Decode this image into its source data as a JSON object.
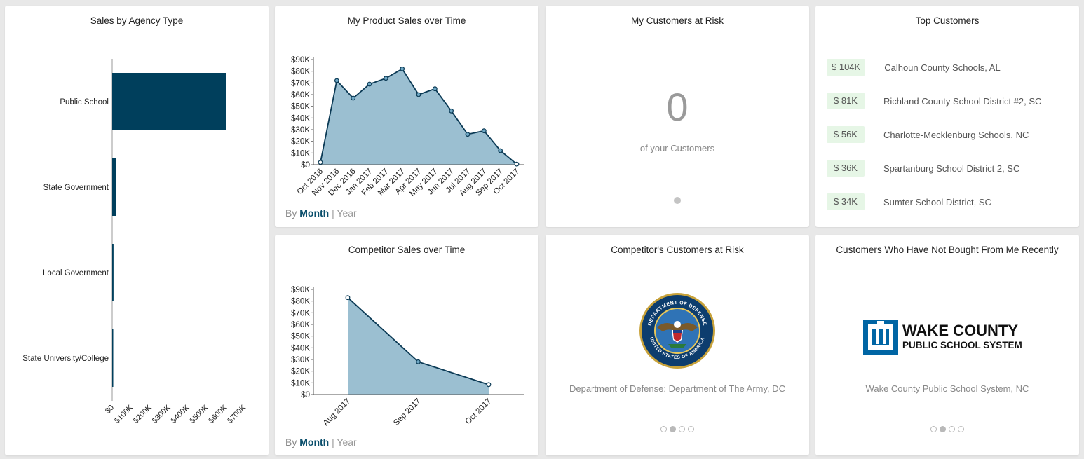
{
  "cards": {
    "agency": {
      "title": "Sales by Agency Type"
    },
    "my_sales": {
      "title": "My Product Sales over Time",
      "by_label": "By",
      "month_label": "Month",
      "sep": "|",
      "year_label": "Year"
    },
    "my_risk": {
      "title": "My Customers at Risk",
      "count": "0",
      "caption": "of your Customers"
    },
    "top_customers": {
      "title": "Top Customers",
      "rows": [
        {
          "amount": "$ 104K",
          "name": "Calhoun County Schools, AL"
        },
        {
          "amount": "$ 81K",
          "name": "Richland County School District #2, SC"
        },
        {
          "amount": "$ 56K",
          "name": "Charlotte-Mecklenburg Schools, NC"
        },
        {
          "amount": "$ 36K",
          "name": "Spartanburg School District 2, SC"
        },
        {
          "amount": "$ 34K",
          "name": "Sumter School District, SC"
        }
      ]
    },
    "competitor_sales": {
      "title": "Competitor Sales over Time",
      "by_label": "By",
      "month_label": "Month",
      "sep": "|",
      "year_label": "Year"
    },
    "competitor_risk": {
      "title": "Competitor's Customers at Risk",
      "caption": "Department of Defense: Department of The Army, DC",
      "seal_text_top": "DEPARTMENT OF DEFENSE",
      "seal_text_bottom": "UNITED STATES OF AMERICA"
    },
    "not_bought": {
      "title": "Customers Who Have Not Bought From Me Recently",
      "caption": "Wake County Public School System, NC",
      "logo_line1": "WAKE COUNTY",
      "logo_line2": "PUBLIC SCHOOL SYSTEM"
    }
  },
  "colors": {
    "navy": "#003f5c",
    "line": "#0b3a55",
    "area": "#9bbfd1",
    "point": "#6ea7c4",
    "badge_bg": "#e6f6e6",
    "wake_blue": "#0065a4"
  },
  "chart_data": [
    {
      "type": "bar",
      "orientation": "horizontal",
      "title": "Sales by Agency Type",
      "categories": [
        "Public School",
        "State Government",
        "Local Government",
        "State University/College"
      ],
      "values": [
        604000,
        22000,
        7000,
        3000
      ],
      "xlim": [
        0,
        700000
      ],
      "ticks": [
        "$0",
        "$100K",
        "$200K",
        "$300K",
        "$400K",
        "$500K",
        "$600K",
        "$700K"
      ]
    },
    {
      "type": "area",
      "title": "My Product Sales over Time",
      "categories": [
        "Oct 2016",
        "Nov 2016",
        "Dec 2016",
        "Jan 2017",
        "Feb 2017",
        "Mar 2017",
        "Apr 2017",
        "May 2017",
        "Jun 2017",
        "Jul 2017",
        "Aug 2017",
        "Sep 2017",
        "Oct 2017"
      ],
      "values": [
        2000,
        72000,
        57000,
        69000,
        74000,
        82000,
        60000,
        65000,
        46000,
        26000,
        29000,
        12000,
        500
      ],
      "ylim": [
        0,
        90000
      ],
      "yticks": [
        "$0",
        "$10K",
        "$20K",
        "$30K",
        "$40K",
        "$50K",
        "$60K",
        "$70K",
        "$80K",
        "$90K"
      ]
    },
    {
      "type": "area",
      "title": "Competitor Sales over Time",
      "categories": [
        "Aug 2017",
        "Sep 2017",
        "Oct 2017"
      ],
      "values": [
        83000,
        28000,
        8500
      ],
      "ylim": [
        0,
        90000
      ],
      "yticks": [
        "$0",
        "$10K",
        "$20K",
        "$30K",
        "$40K",
        "$50K",
        "$60K",
        "$70K",
        "$80K",
        "$90K"
      ]
    }
  ]
}
